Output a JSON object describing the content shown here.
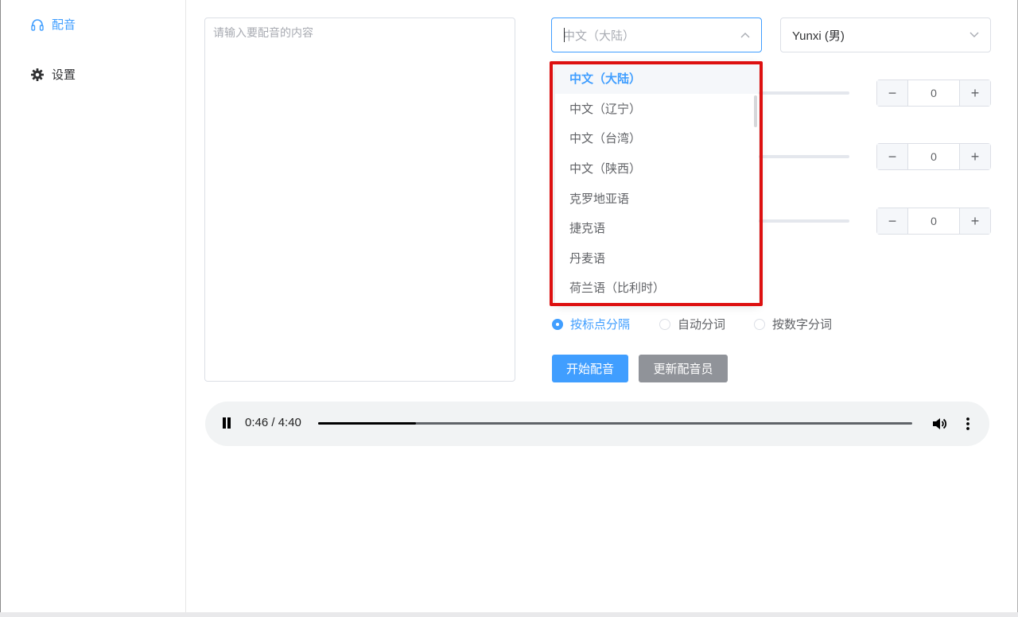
{
  "sidebar": {
    "items": [
      {
        "label": "配音",
        "icon": "headphones-icon",
        "active": true
      },
      {
        "label": "设置",
        "icon": "gear-icon",
        "active": false
      }
    ]
  },
  "editor": {
    "placeholder": "请输入要配音的内容"
  },
  "language_select": {
    "value": "中文（大陆）",
    "expanded": true,
    "options": [
      "中文（大陆）",
      "中文（辽宁）",
      "中文（台湾）",
      "中文（陕西）",
      "克罗地亚语",
      "捷克语",
      "丹麦语",
      "荷兰语（比利时）"
    ]
  },
  "voice_select": {
    "value": "Yunxi (男)"
  },
  "controls": {
    "steppers": [
      {
        "value": "0",
        "minus": "−",
        "plus": "+"
      },
      {
        "value": "0",
        "minus": "−",
        "plus": "+"
      },
      {
        "value": "0",
        "minus": "−",
        "plus": "+"
      }
    ]
  },
  "split_mode": {
    "options": [
      "按标点分隔",
      "自动分词",
      "按数字分词"
    ],
    "selected": 0
  },
  "actions": {
    "start_label": "开始配音",
    "update_label": "更新配音员"
  },
  "player": {
    "time_text": "0:46 / 4:40",
    "progress_fraction": 0.164
  },
  "colors": {
    "accent": "#409eff",
    "highlight": "#dd1010",
    "secondary_button": "#909399"
  }
}
